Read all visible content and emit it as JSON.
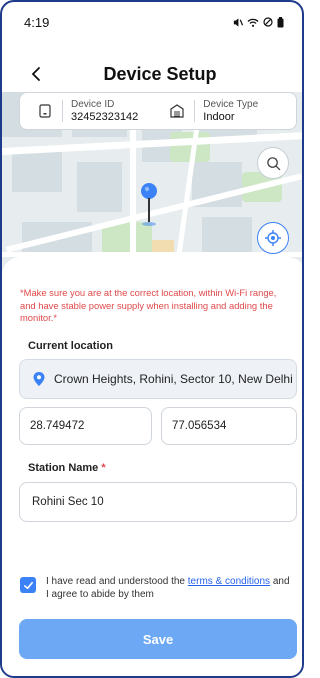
{
  "status_bar": {
    "time": "4:19",
    "icons": [
      "mute-icon",
      "wifi-icon",
      "dnd-icon",
      "battery-icon"
    ]
  },
  "header": {
    "title": "Device Setup",
    "back_icon": "back-arrow-icon"
  },
  "device_card": {
    "device_id_label": "Device ID",
    "device_id_value": "32452323142",
    "device_type_label": "Device Type",
    "device_type_value": "Indoor"
  },
  "map": {
    "search_icon": "search-icon",
    "locate_icon": "my-location-icon",
    "pin_icon": "map-pin-icon"
  },
  "form": {
    "warning": "*Make sure you are at the correct location, within Wi-Fi range, and have stable power supply when installing and adding the monitor.*",
    "current_location_label": "Current location",
    "current_location_value": "Crown Heights, Rohini, Sector 10, New Delhi",
    "latitude": "28.749472",
    "longitude": "77.056534",
    "station_name_label": "Station Name",
    "required_mark": "*",
    "station_name_value": "Rohini Sec 10"
  },
  "terms": {
    "checked": true,
    "text_before": "I have read and understood the ",
    "link_text": "terms & conditions",
    "text_after": " and I agree to abide by them"
  },
  "actions": {
    "save_label": "Save"
  },
  "colors": {
    "accent": "#3b82f6",
    "save_button": "#6ca8f3",
    "warning": "#e0484a",
    "link": "#2563eb"
  }
}
